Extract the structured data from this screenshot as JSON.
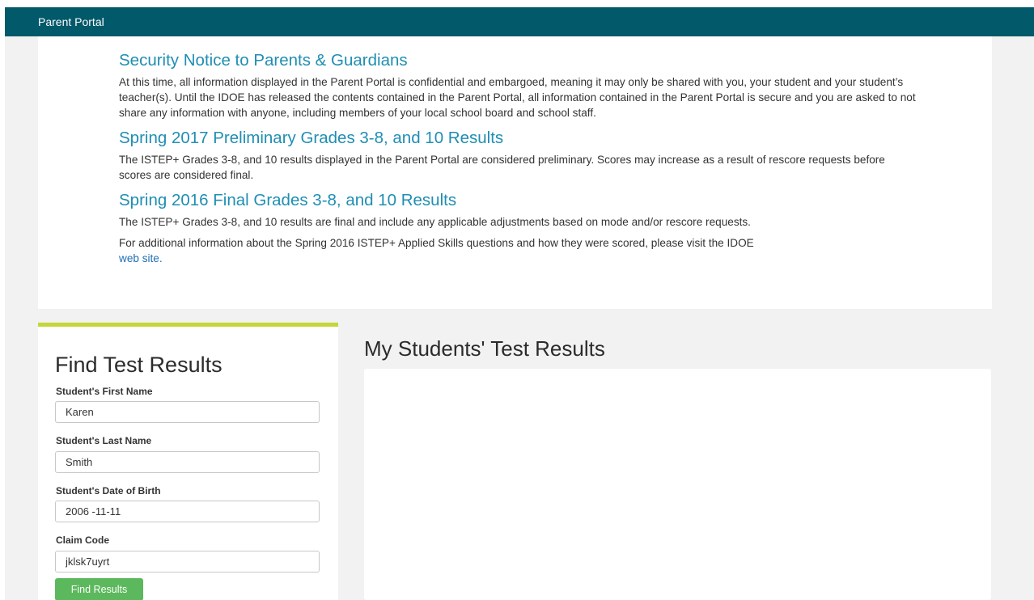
{
  "header": {
    "title": "Parent Portal"
  },
  "notices": [
    {
      "title": "Security Notice to Parents & Guardians",
      "body": "At this time, all information displayed in the Parent Portal is confidential and embargoed, meaning it may only be shared with you, your student and your student’s teacher(s). Until the IDOE has released the contents contained in the Parent Portal, all information contained in the Parent Portal is secure and you are asked to not share any information with anyone, including members of your local school board and school staff."
    },
    {
      "title": "Spring 2017 Preliminary Grades 3-8, and 10 Results",
      "body": "The ISTEP+ Grades 3-8, and 10 results displayed in the Parent Portal are considered preliminary. Scores may increase as a result of rescore requests before scores are considered final."
    },
    {
      "title": "Spring 2016 Final Grades 3-8, and 10 Results",
      "body": "The ISTEP+ Grades 3-8, and 10 results are final and include any applicable adjustments based on mode and/or rescore requests.",
      "body2": "For additional information about the Spring 2016 ISTEP+ Applied Skills questions and how they were scored, please visit the IDOE",
      "link": "web site."
    }
  ],
  "find_form": {
    "title": "Find Test Results",
    "first_name_label": "Student's First Name",
    "first_name_value": "Karen",
    "last_name_label": "Student's Last Name",
    "last_name_value": "Smith",
    "dob_label": "Student's Date of Birth",
    "dob_value": "2006 -11-11",
    "claim_label": "Claim Code",
    "claim_value": "jklsk7uyrt",
    "button_label": "Find Results"
  },
  "results": {
    "title": "My Students' Test Results"
  },
  "colors": {
    "header_bg": "#02596a",
    "heading_blue": "#1f8eb3",
    "panel_accent": "#c5d639",
    "button_green": "#5cb85c"
  }
}
